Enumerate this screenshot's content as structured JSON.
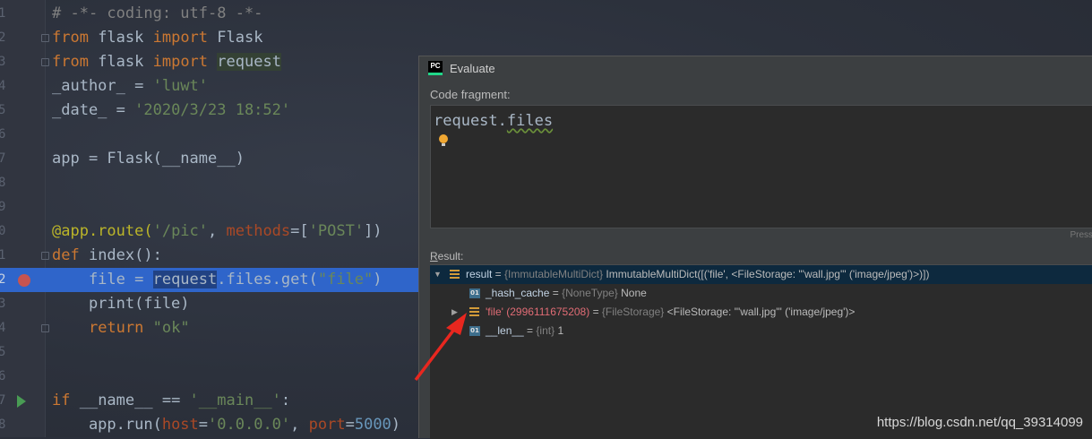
{
  "editor": {
    "lines": [
      {
        "n": "1",
        "parts": [
          [
            "# -*- coding: utf-8 -*-",
            "cmt"
          ]
        ]
      },
      {
        "n": "2",
        "parts": [
          [
            "from",
            "kw"
          ],
          [
            " flask ",
            ""
          ],
          [
            "import",
            "kw"
          ],
          [
            " Flask",
            ""
          ]
        ]
      },
      {
        "n": "3",
        "parts": [
          [
            "from",
            "kw"
          ],
          [
            " flask ",
            ""
          ],
          [
            "import",
            "kw"
          ],
          [
            " ",
            ""
          ],
          [
            "request",
            "ident-hl"
          ]
        ]
      },
      {
        "n": "4",
        "parts": [
          [
            "_author_ = ",
            ""
          ],
          [
            "'luwt'",
            "str"
          ]
        ]
      },
      {
        "n": "5",
        "parts": [
          [
            "_date_ = ",
            ""
          ],
          [
            "'2020/3/23 18:52'",
            "str"
          ]
        ]
      },
      {
        "n": "6",
        "parts": []
      },
      {
        "n": "7",
        "parts": [
          [
            "app = Flask(__name__)",
            ""
          ]
        ]
      },
      {
        "n": "8",
        "parts": []
      },
      {
        "n": "9",
        "parts": []
      },
      {
        "n": "0",
        "parts": [
          [
            "@app.route(",
            "deco"
          ],
          [
            "'/pic'",
            "str"
          ],
          [
            ", ",
            ""
          ],
          [
            "methods",
            "param"
          ],
          [
            "=[",
            ""
          ],
          [
            "'POST'",
            "str"
          ],
          [
            "])",
            ""
          ]
        ]
      },
      {
        "n": "1",
        "parts": [
          [
            "def",
            "kw"
          ],
          [
            " index():",
            ""
          ]
        ]
      },
      {
        "n": "2",
        "parts": [
          [
            "    file = ",
            ""
          ],
          [
            "request",
            "selword"
          ],
          [
            ".files.get(",
            ""
          ],
          [
            "\"file\"",
            "str"
          ],
          [
            ")",
            ""
          ]
        ],
        "highlight": true,
        "breakpoint": true
      },
      {
        "n": "3",
        "parts": [
          [
            "    print(file)",
            ""
          ]
        ]
      },
      {
        "n": "4",
        "parts": [
          [
            "    ",
            ""
          ],
          [
            "return",
            "kw"
          ],
          [
            " ",
            ""
          ],
          [
            "\"ok\"",
            "str"
          ]
        ]
      },
      {
        "n": "5",
        "parts": []
      },
      {
        "n": "6",
        "parts": []
      },
      {
        "n": "7",
        "parts": [
          [
            "if",
            "kw"
          ],
          [
            " __name__ == ",
            ""
          ],
          [
            "'__main__'",
            "str"
          ],
          [
            ":",
            ""
          ]
        ],
        "run": true
      },
      {
        "n": "8",
        "parts": [
          [
            "    app.run(",
            ""
          ],
          [
            "host",
            "param"
          ],
          [
            "=",
            ""
          ],
          [
            "'0.0.0.0'",
            "str"
          ],
          [
            ", ",
            ""
          ],
          [
            "port",
            "param"
          ],
          [
            "=",
            ""
          ],
          [
            "5000",
            "num"
          ],
          [
            ")",
            ""
          ]
        ]
      }
    ]
  },
  "dialog": {
    "icon_text": "PC",
    "title": "Evaluate",
    "fragment_label": "Code fragment:",
    "fragment_part1": "request.",
    "fragment_part2": "files",
    "press_hint": "Press",
    "result_label_u": "R",
    "result_label_rest": "esult:",
    "rows": [
      {
        "name": "result",
        "type": "{ImmutableMultiDict}",
        "value": "ImmutableMultiDict([('file', <FileStorage: \"'wall.jpg'\" ('image/jpeg')>)])",
        "icon": "list",
        "toggle": "▼",
        "selected": true,
        "indent": 0
      },
      {
        "name": "_hash_cache",
        "type": "{NoneType}",
        "value": "None",
        "icon": "01",
        "toggle": "",
        "indent": 1
      },
      {
        "name": "'file' (2996111675208)",
        "type": "{FileStorage}",
        "value": "<FileStorage: \"'wall.jpg'\" ('image/jpeg')>",
        "icon": "list",
        "toggle": "▶",
        "indent": 1,
        "red": true
      },
      {
        "name": "__len__",
        "type": "{int}",
        "value": "1",
        "icon": "01",
        "toggle": "",
        "indent": 1
      }
    ]
  },
  "watermark": "https://blog.csdn.net/qq_39314099",
  "colors": {
    "arrow": "#e8271f",
    "selection": "#2f65ca"
  }
}
